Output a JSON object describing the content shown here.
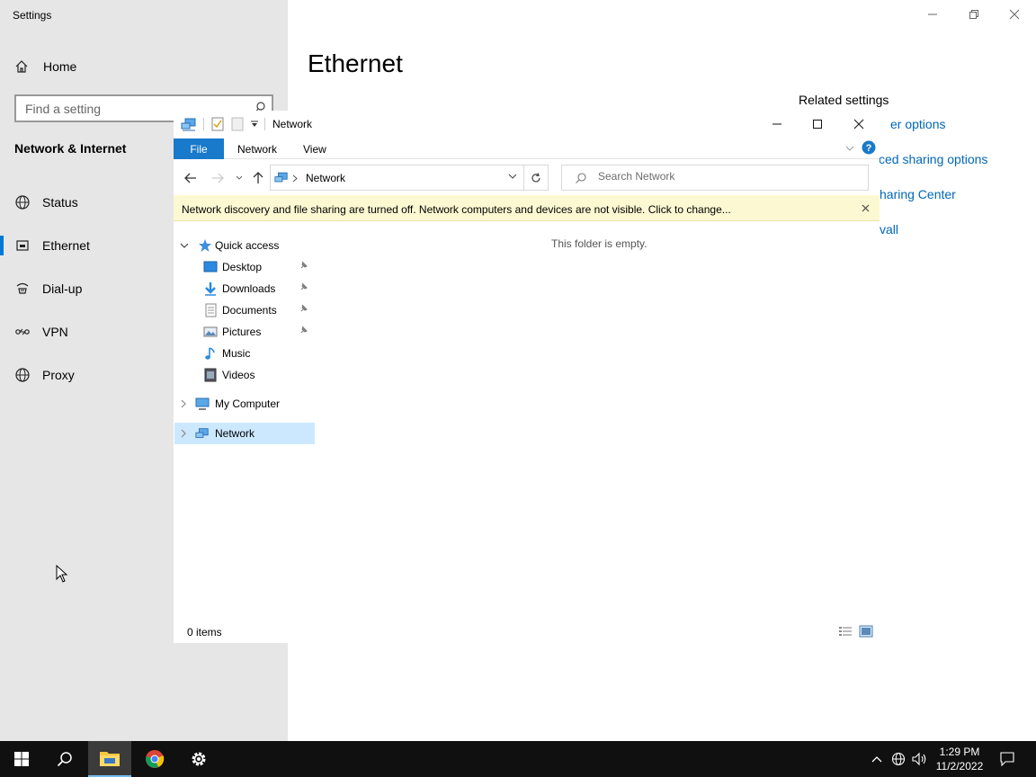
{
  "settings": {
    "window_title": "Settings",
    "home_label": "Home",
    "search_placeholder": "Find a setting",
    "section_title": "Network & Internet",
    "nav": [
      {
        "label": "Status",
        "icon": "globe-icon"
      },
      {
        "label": "Ethernet",
        "icon": "ethernet-icon",
        "selected": true
      },
      {
        "label": "Dial-up",
        "icon": "dialup-icon"
      },
      {
        "label": "VPN",
        "icon": "vpn-icon"
      },
      {
        "label": "Proxy",
        "icon": "globe-icon"
      }
    ],
    "page_title": "Ethernet",
    "related_title": "Related settings",
    "related_links": [
      "er options",
      "ced sharing options",
      "haring Center",
      "vall"
    ],
    "accent_color": "#0078d7",
    "link_color": "#0067b8"
  },
  "explorer": {
    "title": "Network",
    "ribbon_tabs": {
      "file": "File",
      "network": "Network",
      "view": "View"
    },
    "address_crumb": "Network",
    "search_placeholder": "Search Network",
    "info_bar": "Network discovery and file sharing are turned off. Network computers and devices are not visible. Click to change...",
    "empty_message": "This folder is empty.",
    "tree": {
      "quick_access": "Quick access",
      "items": [
        "Desktop",
        "Downloads",
        "Documents",
        "Pictures",
        "Music",
        "Videos"
      ],
      "my_computer": "My Computer",
      "network": "Network"
    },
    "status_count": "0 items",
    "file_tab_color": "#1979ca",
    "infobar_color": "#fcf9d2",
    "selected_color": "#cce8ff"
  },
  "taskbar": {
    "time": "1:29 PM",
    "date": "11/2/2022",
    "apps": [
      "start-icon",
      "search-icon",
      "file-explorer-icon",
      "chrome-icon",
      "settings-gear-icon"
    ]
  }
}
